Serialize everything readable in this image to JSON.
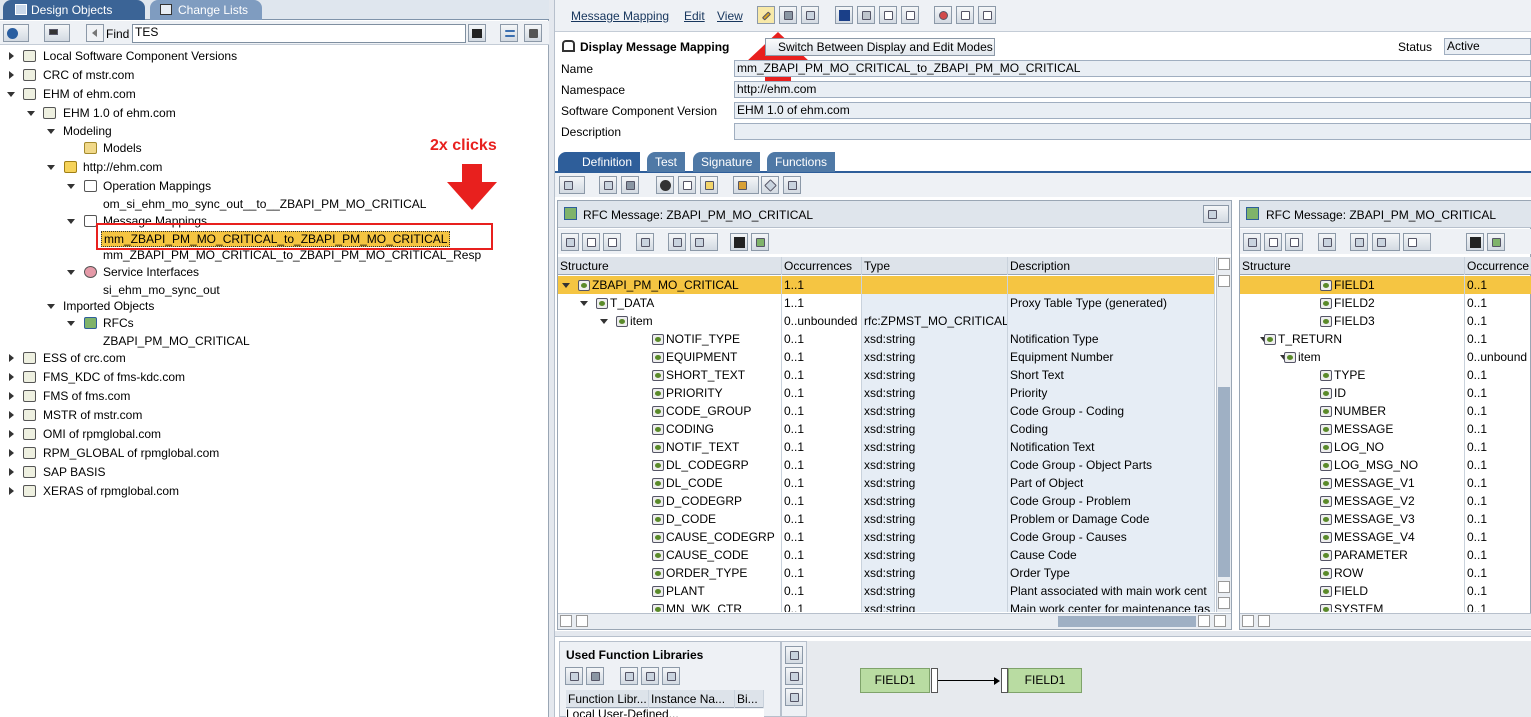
{
  "left_tabs": {
    "design": "Design Objects",
    "change": "Change Lists"
  },
  "find": {
    "label": "Find",
    "value": "TES"
  },
  "tree": {
    "items": [
      {
        "label": "Local Software Component Versions"
      },
      {
        "label": "CRC of mstr.com"
      },
      {
        "label": "EHM of ehm.com"
      },
      {
        "label": "EHM 1.0 of ehm.com"
      },
      {
        "label": "Modeling"
      },
      {
        "label": "Models"
      },
      {
        "label": "http://ehm.com"
      },
      {
        "label": "Operation Mappings"
      },
      {
        "label": "om_si_ehm_mo_sync_out__to__ZBAPI_PM_MO_CRITICAL"
      },
      {
        "label": "Message Mappings"
      },
      {
        "label": "mm_ZBAPI_PM_MO_CRITICAL_to_ZBAPI_PM_MO_CRITICAL"
      },
      {
        "label": "mm_ZBAPI_PM_MO_CRITICAL_to_ZBAPI_PM_MO_CRITICAL_Resp"
      },
      {
        "label": "Service Interfaces"
      },
      {
        "label": "si_ehm_mo_sync_out"
      },
      {
        "label": "Imported Objects"
      },
      {
        "label": "RFCs"
      },
      {
        "label": "ZBAPI_PM_MO_CRITICAL"
      },
      {
        "label": "ESS of crc.com"
      },
      {
        "label": "FMS_KDC of fms-kdc.com"
      },
      {
        "label": "FMS of fms.com"
      },
      {
        "label": "MSTR of mstr.com"
      },
      {
        "label": "OMI of rpmglobal.com"
      },
      {
        "label": "RPM_GLOBAL of rpmglobal.com"
      },
      {
        "label": "SAP BASIS"
      },
      {
        "label": "XERAS of rpmglobal.com"
      }
    ]
  },
  "annotation": {
    "text": "2x clicks",
    "color": "#e8201e"
  },
  "menu": {
    "message_mapping": "Message Mapping",
    "edit": "Edit",
    "view": "View"
  },
  "header": {
    "title": "Display Message Mapping",
    "switch_btn": "Switch Between Display and Edit Modes",
    "status_label": "Status",
    "status_value": "Active"
  },
  "form": {
    "name_label": "Name",
    "name_value": "mm_ZBAPI_PM_MO_CRITICAL_to_ZBAPI_PM_MO_CRITICAL",
    "ns_label": "Namespace",
    "ns_value": "http://ehm.com",
    "scv_label": "Software Component Version",
    "scv_value": "EHM 1.0 of ehm.com",
    "desc_label": "Description",
    "desc_value": ""
  },
  "tabs": {
    "definition": "Definition",
    "test": "Test",
    "signature": "Signature",
    "functions": "Functions"
  },
  "source": {
    "title": "RFC Message: ZBAPI_PM_MO_CRITICAL",
    "columns": [
      "Structure",
      "Occurrences",
      "Type",
      "Description"
    ],
    "rows": [
      {
        "s": "ZBAPI_PM_MO_CRITICAL",
        "o": "1..1",
        "t": "",
        "d": ""
      },
      {
        "s": "T_DATA",
        "o": "1..1",
        "t": "",
        "d": "Proxy Table Type (generated)"
      },
      {
        "s": "item",
        "o": "0..unbounded",
        "t": "rfc:ZPMST_MO_CRITICAL",
        "d": ""
      },
      {
        "s": "NOTIF_TYPE",
        "o": "0..1",
        "t": "xsd:string",
        "d": "Notification Type"
      },
      {
        "s": "EQUIPMENT",
        "o": "0..1",
        "t": "xsd:string",
        "d": "Equipment Number"
      },
      {
        "s": "SHORT_TEXT",
        "o": "0..1",
        "t": "xsd:string",
        "d": "Short Text"
      },
      {
        "s": "PRIORITY",
        "o": "0..1",
        "t": "xsd:string",
        "d": "Priority"
      },
      {
        "s": "CODE_GROUP",
        "o": "0..1",
        "t": "xsd:string",
        "d": "Code Group - Coding"
      },
      {
        "s": "CODING",
        "o": "0..1",
        "t": "xsd:string",
        "d": "Coding"
      },
      {
        "s": "NOTIF_TEXT",
        "o": "0..1",
        "t": "xsd:string",
        "d": "Notification Text"
      },
      {
        "s": "DL_CODEGRP",
        "o": "0..1",
        "t": "xsd:string",
        "d": "Code Group - Object Parts"
      },
      {
        "s": "DL_CODE",
        "o": "0..1",
        "t": "xsd:string",
        "d": "Part of Object"
      },
      {
        "s": "D_CODEGRP",
        "o": "0..1",
        "t": "xsd:string",
        "d": "Code Group - Problem"
      },
      {
        "s": "D_CODE",
        "o": "0..1",
        "t": "xsd:string",
        "d": "Problem or Damage Code"
      },
      {
        "s": "CAUSE_CODEGRP",
        "o": "0..1",
        "t": "xsd:string",
        "d": "Code Group - Causes"
      },
      {
        "s": "CAUSE_CODE",
        "o": "0..1",
        "t": "xsd:string",
        "d": "Cause Code"
      },
      {
        "s": "ORDER_TYPE",
        "o": "0..1",
        "t": "xsd:string",
        "d": "Order Type"
      },
      {
        "s": "PLANT",
        "o": "0..1",
        "t": "xsd:string",
        "d": "Plant associated with main work cent"
      },
      {
        "s": "MN_WK_CTR",
        "o": "0..1",
        "t": "xsd:string",
        "d": "Main work center for maintenance tas"
      }
    ]
  },
  "target": {
    "title": "RFC Message: ZBAPI_PM_MO_CRITICAL",
    "columns": [
      "Structure",
      "Occurrence"
    ],
    "rows": [
      {
        "s": "FIELD1",
        "o": "0..1"
      },
      {
        "s": "FIELD2",
        "o": "0..1"
      },
      {
        "s": "FIELD3",
        "o": "0..1"
      },
      {
        "s": "T_RETURN",
        "o": "0..1"
      },
      {
        "s": "item",
        "o": "0..unbound"
      },
      {
        "s": "TYPE",
        "o": "0..1"
      },
      {
        "s": "ID",
        "o": "0..1"
      },
      {
        "s": "NUMBER",
        "o": "0..1"
      },
      {
        "s": "MESSAGE",
        "o": "0..1"
      },
      {
        "s": "LOG_NO",
        "o": "0..1"
      },
      {
        "s": "LOG_MSG_NO",
        "o": "0..1"
      },
      {
        "s": "MESSAGE_V1",
        "o": "0..1"
      },
      {
        "s": "MESSAGE_V2",
        "o": "0..1"
      },
      {
        "s": "MESSAGE_V3",
        "o": "0..1"
      },
      {
        "s": "MESSAGE_V4",
        "o": "0..1"
      },
      {
        "s": "PARAMETER",
        "o": "0..1"
      },
      {
        "s": "ROW",
        "o": "0..1"
      },
      {
        "s": "FIELD",
        "o": "0..1"
      },
      {
        "s": "SYSTEM",
        "o": "0..1"
      }
    ]
  },
  "func_libs": {
    "title": "Used Function Libraries",
    "col1": "Function Libr...",
    "col2": "Instance Na...",
    "col3": "Bi...",
    "partial": "Local User-Defined..."
  },
  "mapping": {
    "left": "FIELD1",
    "right": "FIELD1"
  }
}
